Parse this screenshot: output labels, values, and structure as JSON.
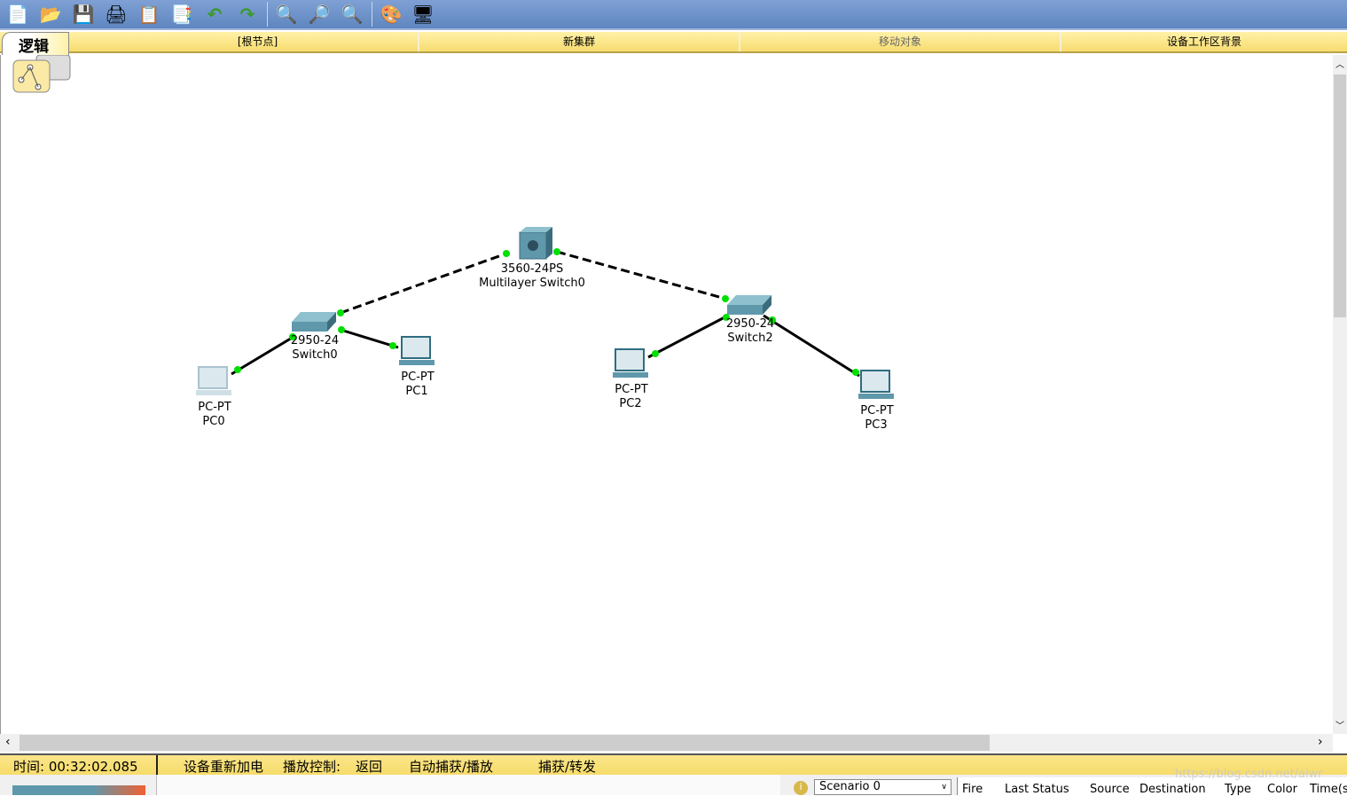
{
  "toolbar": {
    "icons": [
      "new-file-icon",
      "open-folder-icon",
      "save-icon",
      "print-icon",
      "copy-icon",
      "paste-icon",
      "undo-icon",
      "redo-icon",
      "zoom-in-icon",
      "zoom-reset-icon",
      "zoom-out-icon",
      "palette-icon",
      "custom-device-icon"
    ]
  },
  "topbar": {
    "logic_tab": "逻辑",
    "root": "[根节点]",
    "new_cluster": "新集群",
    "move_object": "移动对象",
    "workspace_bg": "设备工作区背景"
  },
  "devices": [
    {
      "model": "3560-24PS",
      "name": "Multilayer Switch0",
      "type": "multilayer-switch"
    },
    {
      "model": "2950-24",
      "name": "Switch0",
      "type": "switch"
    },
    {
      "model": "2950-24",
      "name": "Switch2",
      "type": "switch"
    },
    {
      "model": "PC-PT",
      "name": "PC0",
      "type": "pc"
    },
    {
      "model": "PC-PT",
      "name": "PC1",
      "type": "pc"
    },
    {
      "model": "PC-PT",
      "name": "PC2",
      "type": "pc"
    },
    {
      "model": "PC-PT",
      "name": "PC3",
      "type": "pc"
    }
  ],
  "links_status_color": "#00e000",
  "status": {
    "time": "时间: 00:32:02.085",
    "power_cycle": "设备重新加电",
    "playback": "播放控制:",
    "back": "返回",
    "auto_capture": "自动捕获/播放",
    "capture_forward": "捕获/转发"
  },
  "scenario": {
    "selected": "Scenario 0",
    "columns": [
      "Fire",
      "Last Status",
      "Source",
      "Destination",
      "Type",
      "Color",
      "Time(s"
    ]
  },
  "watermark": "https://blog.csdn.net/aiwr"
}
